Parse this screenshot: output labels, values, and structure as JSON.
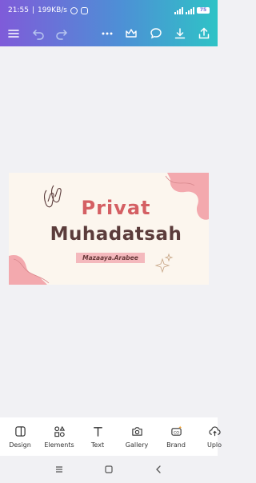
{
  "status_bar": {
    "time": "21:55",
    "network_speed": "199KB/s",
    "battery": "75"
  },
  "toolbar": {
    "icons": [
      "menu-icon",
      "undo-icon",
      "redo-icon",
      "more-icon",
      "crown-icon",
      "comment-icon",
      "download-icon",
      "share-icon"
    ]
  },
  "design": {
    "title_line1": "Privat",
    "title_line2": "Muhadatsah",
    "tagline": "Mazaaya.Arabee",
    "colors": {
      "background": "#fcf6ee",
      "title1": "#d45f63",
      "title2": "#5b3c3b",
      "blob": "#f3a9ae"
    }
  },
  "bottom_bar": {
    "items": [
      {
        "label": "Design",
        "icon": "design-icon"
      },
      {
        "label": "Elements",
        "icon": "elements-icon"
      },
      {
        "label": "Text",
        "icon": "text-icon"
      },
      {
        "label": "Gallery",
        "icon": "camera-icon"
      },
      {
        "label": "Brand",
        "icon": "brand-icon"
      },
      {
        "label": "Uplo",
        "icon": "upload-icon"
      }
    ]
  },
  "colors": {
    "accent_start": "#7f5bd9",
    "accent_end": "#2ec3c6"
  }
}
